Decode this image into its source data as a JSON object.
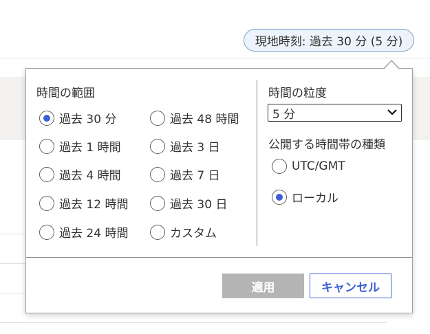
{
  "header": {
    "time_range_pill": "現地時刻: 過去 30 分 (5 分)"
  },
  "panel": {
    "time_range": {
      "title": "時間の範囲",
      "selected": "過去 30 分",
      "options": [
        "過去 30 分",
        "過去 1 時間",
        "過去 4 時間",
        "過去 12 時間",
        "過去 24 時間",
        "過去 48 時間",
        "過去 3 日",
        "過去 7 日",
        "過去 30 日",
        "カスタム"
      ]
    },
    "granularity": {
      "title": "時間の粒度",
      "value": "5 分"
    },
    "timezone": {
      "title": "公開する時間帯の種類",
      "selected": "ローカル",
      "options": [
        "UTC/GMT",
        "ローカル"
      ]
    },
    "buttons": {
      "apply": "適用",
      "cancel": "キャンセル"
    }
  },
  "colors": {
    "accent": "#3b5fd9",
    "pill_bg": "#edf3fb",
    "apply_disabled_bg": "#b4b4b4"
  }
}
